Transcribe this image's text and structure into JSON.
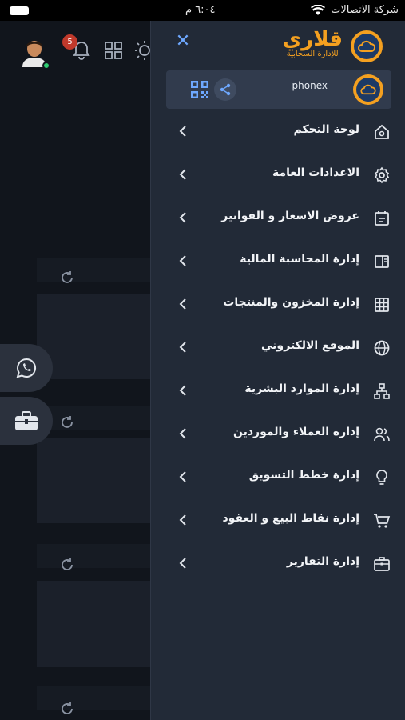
{
  "status": {
    "carrier": "شركة الاتصالات",
    "time": "٦:٠٤ م"
  },
  "header": {
    "notification_count": "5"
  },
  "drawer": {
    "brand_name": "قلاري",
    "brand_sub": "للإدارة السحابية",
    "close_symbol": "✕",
    "account": {
      "username": "phonex"
    },
    "menu": [
      {
        "label": "لوحة التحكم",
        "icon": "home-icon"
      },
      {
        "label": "الاعدادات العامة",
        "icon": "gear-icon"
      },
      {
        "label": "عروض الاسعار و الفواتير",
        "icon": "calendar-icon"
      },
      {
        "label": "إدارة المحاسبة المالية",
        "icon": "book-icon"
      },
      {
        "label": "إدارة المخزون والمنتجات",
        "icon": "table-icon"
      },
      {
        "label": "الموقع الالكتروني",
        "icon": "globe-icon"
      },
      {
        "label": "إدارة الموارد البشرية",
        "icon": "org-chart-icon"
      },
      {
        "label": "إدارة العملاء والموردين",
        "icon": "users-icon"
      },
      {
        "label": "إدارة خطط التسويق",
        "icon": "lightbulb-icon"
      },
      {
        "label": "إدارة نقاط البيع و العقود",
        "icon": "cart-icon"
      },
      {
        "label": "إدارة التقارير",
        "icon": "briefcase-icon"
      }
    ]
  },
  "colors": {
    "accent": "#6ea8ff",
    "brand": "#f4a020",
    "drawer_bg": "#222a37",
    "online": "#2ecc71",
    "badge": "#c0392b"
  }
}
